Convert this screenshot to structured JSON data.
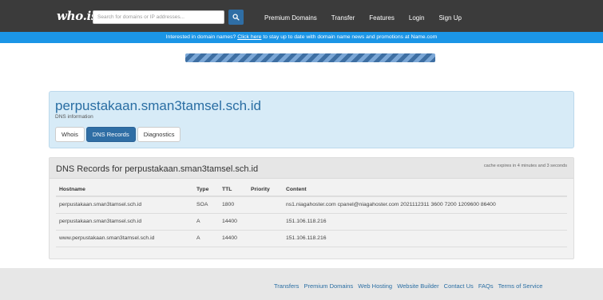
{
  "topbar": {
    "logo": "who.is",
    "search": {
      "placeholder": "Search for domains or IP addresses..."
    },
    "nav": [
      "Premium Domains",
      "Transfer",
      "Features",
      "Login",
      "Sign Up"
    ]
  },
  "promo": {
    "before": "Interested in domain names? ",
    "link": "Click here",
    "after": " to stay up to date with domain name news and promotions at Name.com"
  },
  "progress": {
    "value": 1.0
  },
  "header": {
    "title": "perpustakaan.sman3tamsel.sch.id",
    "subtitle": "DNS information",
    "tabs": [
      {
        "label": "Whois",
        "active": false
      },
      {
        "label": "DNS Records",
        "active": true
      },
      {
        "label": "Diagnostics",
        "active": false
      }
    ]
  },
  "dns": {
    "title": "DNS Records for perpustakaan.sman3tamsel.sch.id",
    "cache_note": "cache expires in 4 minutes and 3 seconds",
    "columns": [
      "Hostname",
      "Type",
      "TTL",
      "Priority",
      "Content"
    ],
    "rows": [
      [
        "perpustakaan.sman3tamsel.sch.id",
        "SOA",
        "1800",
        "",
        "ns1.niagahoster.com cpanel@niagahoster.com 2021112311 3600 7200 1209600 86400"
      ],
      [
        "perpustakaan.sman3tamsel.sch.id",
        "A",
        "14400",
        "",
        "151.106.118.216"
      ],
      [
        "www.perpustakaan.sman3tamsel.sch.id",
        "A",
        "14400",
        "",
        "151.106.118.216"
      ]
    ]
  },
  "footer": {
    "links": [
      "Transfers",
      "Premium Domains",
      "Web Hosting",
      "Website Builder",
      "Contact Us",
      "FAQs",
      "Terms of Service"
    ]
  },
  "colors": {
    "topbar": "#3b3b3b",
    "promo": "#1b95e6",
    "accent": "#2f6ea5",
    "header_panel": "#d7ebf7"
  },
  "icons": {
    "search_button": "search-icon"
  }
}
